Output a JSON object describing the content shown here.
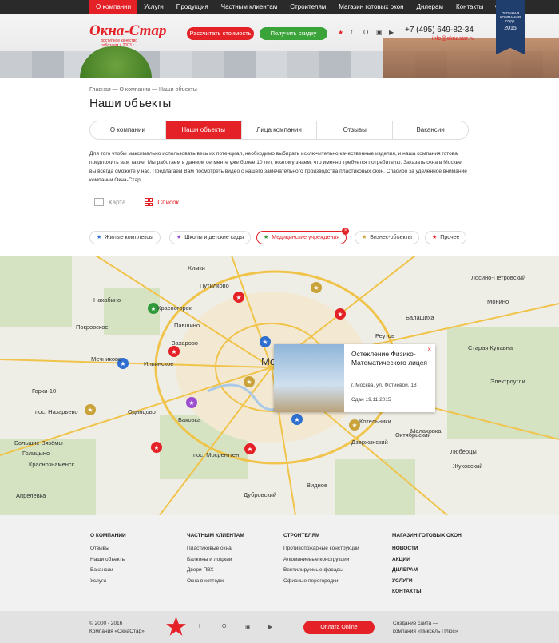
{
  "topnav": [
    "О компании",
    "Услуги",
    "Продукция",
    "Частным клиентам",
    "Строителям",
    "Магазин готовых окон",
    "Дилерам",
    "Контакты"
  ],
  "header": {
    "logo_name": "Окна-Стар",
    "logo_sub": "доступное качество",
    "logo_sub2": "работаем с 2003 г",
    "calc_button": "Рассчитать стоимость",
    "discount_button": "Получить скидку",
    "phone": "+7 (495) 649-82-34",
    "email": "info@oknastar.ru",
    "badge_text": "ОКОННАЯ КОМПАНИЯ ГОДА",
    "badge_year": "2015"
  },
  "breadcrumb": "Главная — О компании — Наши объекты",
  "page_title": "Наши объекты",
  "tabs": [
    "О компании",
    "Наши объекты",
    "Лица компании",
    "Отзывы",
    "Вакансии"
  ],
  "intro": "Для того чтобы максимально использовать весь их потенциал, необходимо выбирать исключительно качественные изделия, и наша компания готова предложить вам такие. Мы работаем в данном сегменте уже более 10 лет, поэтому знаем, что именно требуется потребителю. Заказать окна в Москве вы всегда сможете у нас. Предлагаем Вам посмотреть видео с нашего замечательного производства пластиковых окон. Спасибо за уделенное внимание компании Окна-Стар!",
  "view": {
    "map": "Карта",
    "list": "Список"
  },
  "filters": [
    {
      "label": "Жилые комплексы",
      "color": "#2f6fd0"
    },
    {
      "label": "Школы и детские сады",
      "color": "#9b4fd0"
    },
    {
      "label": "Медицинские учреждения",
      "color": "#2f9a3a"
    },
    {
      "label": "Бизнес-объекты",
      "color": "#c9a23a"
    },
    {
      "label": "Прочее",
      "color": "#e32126"
    }
  ],
  "map_labels": [
    "Химки",
    "Путилково",
    "Нахабино",
    "Красногорск",
    "Павшино",
    "Покровское",
    "Мечниково",
    "Ильинское",
    "Захарово",
    "Горки-10",
    "пос. Назарьево",
    "Одинцово",
    "Баковка",
    "Большие Вязёмы",
    "Голицыно",
    "Краснознаменск",
    "Апрелевка",
    "пос. Мосрентген",
    "Видное",
    "Котельники",
    "Дзержинский",
    "Октябрьский",
    "Малаховка",
    "Жуковский",
    "Люберцы",
    "Балашиха",
    "Реутов",
    "Лосино-Петровский",
    "Монино",
    "Старая Купавна",
    "Электроугли",
    "Дубровский",
    "Москва"
  ],
  "popup": {
    "title": "Остекление Физико-Математического лицея",
    "address": "г. Москва, ул. Фотиевой, 18",
    "date": "Сдан 19.11.2015"
  },
  "footer": {
    "col1": {
      "heading": "О КОМПАНИИ",
      "links": [
        "Отзывы",
        "Наши объекты",
        "Вакансии",
        "Услуги"
      ]
    },
    "col2": {
      "heading": "ЧАСТНЫМ КЛИЕНТАМ",
      "links": [
        "Пластиковые окна",
        "Балконы и лоджии",
        "Двери ПВХ",
        "Окна в коттедж"
      ]
    },
    "col3": {
      "heading": "СТРОИТЕЛЯМ",
      "links": [
        "Противопожарные конструкции",
        "Алюминиевые конструкции",
        "Вентилируемые фасады",
        "Офисные перегородки"
      ]
    },
    "col4": {
      "heading": "МАГАЗИН ГОТОВЫХ ОКОН",
      "links": [
        "НОВОСТИ",
        "АКЦИИ",
        "ДИЛЕРАМ",
        "УСЛУГИ",
        "КОНТАКТЫ"
      ]
    }
  },
  "bottom": {
    "copy1": "© 2000 - 2016",
    "copy2": "Компания «ОкнаСтар»",
    "pay": "Оплата Online",
    "creator1": "Создание сайта —",
    "creator2": "компания «Пиксель Плюс»"
  }
}
